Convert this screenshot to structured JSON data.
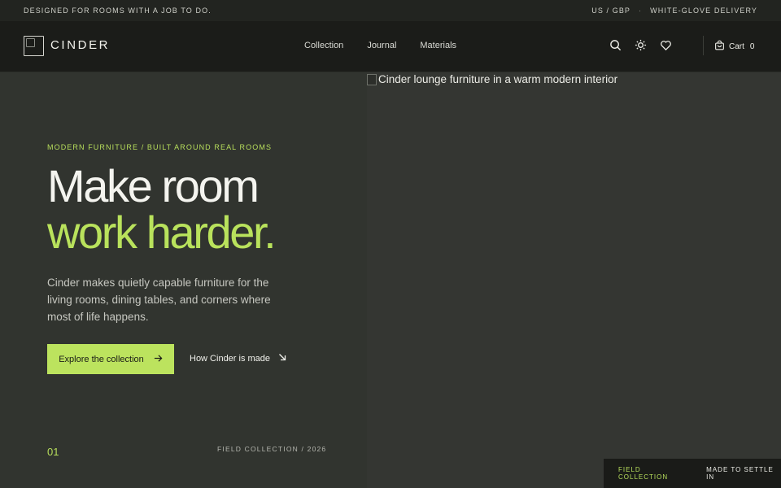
{
  "announcement": {
    "left": "DESIGNED FOR ROOMS WITH A JOB TO DO.",
    "region": "US / GBP",
    "separator": "·",
    "delivery": "WHITE-GLOVE DELIVERY"
  },
  "header": {
    "brand": "CINDER",
    "nav": [
      "Collection",
      "Journal",
      "Materials"
    ],
    "cart_label": "Cart",
    "cart_count": "0",
    "icons": [
      "search-icon",
      "theme-toggle-icon",
      "heart-icon",
      "cart-icon"
    ]
  },
  "hero": {
    "image_alt": "Cinder lounge furniture in a warm modern interior",
    "eyebrow": "MODERN FURNITURE / BUILT AROUND REAL ROOMS",
    "headline_line1": "Make room",
    "headline_line2": "work harder.",
    "body": "Cinder makes quietly capable furniture for the living rooms, dining tables, and corners where most of life happens.",
    "primary_cta": "Explore the collection",
    "secondary_link": "How Cinder is made",
    "index": "01",
    "field_label": "FIELD COLLECTION / 2026"
  },
  "footer_bar": {
    "left": "FIELD COLLECTION",
    "right": "MADE TO SETTLE IN"
  },
  "colors": {
    "background": "#31342f",
    "header": "#1b1c19",
    "accent": "#b9e25c"
  }
}
